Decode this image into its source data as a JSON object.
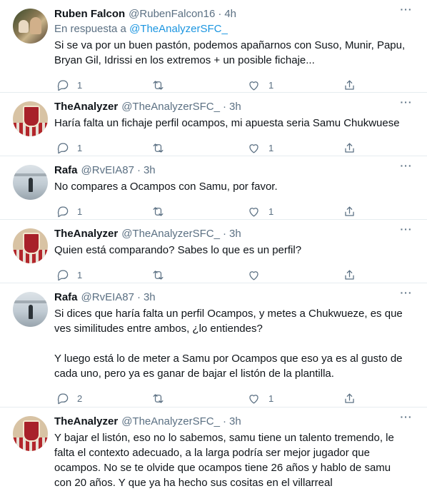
{
  "tweets": [
    {
      "name": "Ruben Falcon",
      "handle": "@RubenFalcon16",
      "time": "4h",
      "reply_prefix": "En respuesta a ",
      "reply_mention": "@TheAnalyzerSFC_",
      "text": "Si se va por un buen pastón, podemos apañarnos con Suso, Munir, Papu, Bryan Gil, Idrissi en los extremos + un posible fichaje...",
      "replies": "1",
      "retweets": "",
      "likes": "1"
    },
    {
      "name": "TheAnalyzer",
      "handle": "@TheAnalyzerSFC_",
      "time": "3h",
      "text": "Haría falta un fichaje perfil ocampos, mi apuesta seria Samu Chukwuese",
      "replies": "1",
      "retweets": "",
      "likes": "1"
    },
    {
      "name": "Rafa",
      "handle": "@RvEIA87",
      "time": "3h",
      "text": "No compares a Ocampos con Samu, por favor.",
      "replies": "1",
      "retweets": "",
      "likes": "1"
    },
    {
      "name": "TheAnalyzer",
      "handle": "@TheAnalyzerSFC_",
      "time": "3h",
      "text": "Quien está comparando? Sabes lo que es un perfil?",
      "replies": "1",
      "retweets": "",
      "likes": ""
    },
    {
      "name": "Rafa",
      "handle": "@RvEIA87",
      "time": "3h",
      "text": "Si dices que haría falta un perfil Ocampos, y metes a Chukwueze, es que ves similitudes entre ambos, ¿lo entiendes?\n\nY luego está lo de meter a Samu por Ocampos que eso ya es al gusto de cada uno, pero ya es ganar de bajar el listón de la plantilla.",
      "replies": "2",
      "retweets": "",
      "likes": "1"
    },
    {
      "name": "TheAnalyzer",
      "handle": "@TheAnalyzerSFC_",
      "time": "3h",
      "text": "Y bajar el listón, eso no lo sabemos, samu tiene un talento tremendo, le falta el contexto adecuado, a la larga podría ser mejor jugador que ocampos. No se te olvide que ocampos tiene 26 años y hablo de samu con 20 años. Y que ya ha hecho sus cositas en el villarreal"
    }
  ],
  "separator": "·",
  "more_glyph": "···"
}
